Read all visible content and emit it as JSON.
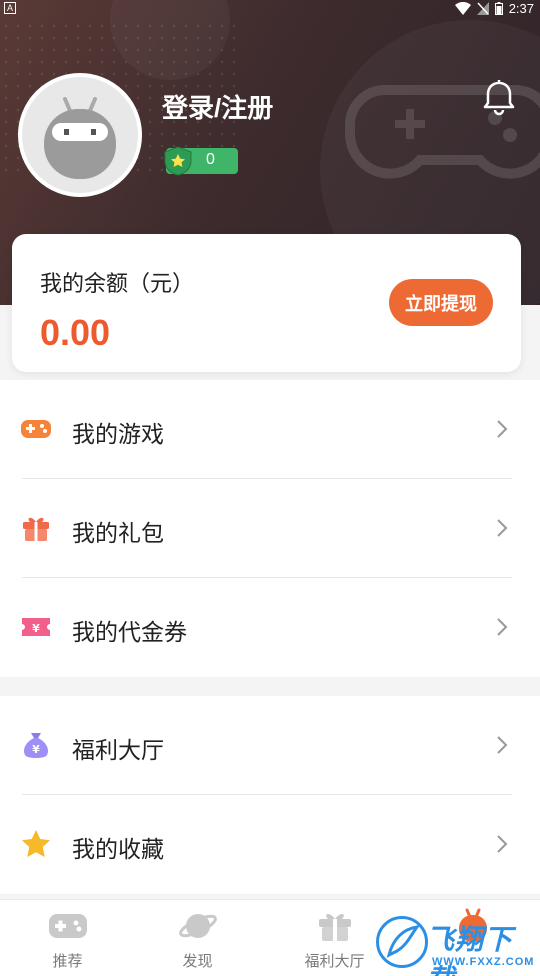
{
  "status_bar": {
    "time": "2:37",
    "left_indicator": "A"
  },
  "profile": {
    "login_label": "登录/注册",
    "level_value": "0"
  },
  "balance": {
    "title": "我的余额（元）",
    "amount": "0.00",
    "withdraw_label": "立即提现"
  },
  "menu_group_1": [
    {
      "label": "我的游戏",
      "icon": "gamepad-icon"
    },
    {
      "label": "我的礼包",
      "icon": "gift-icon"
    },
    {
      "label": "我的代金券",
      "icon": "voucher-icon"
    }
  ],
  "menu_group_2": [
    {
      "label": "福利大厅",
      "icon": "money-bag-icon"
    },
    {
      "label": "我的收藏",
      "icon": "star-icon"
    }
  ],
  "tabs": [
    {
      "label": "推荐",
      "icon": "gamepad-icon"
    },
    {
      "label": "发现",
      "icon": "planet-icon"
    },
    {
      "label": "福利大厅",
      "icon": "gift-icon"
    },
    {
      "label": "",
      "icon": "robot-icon"
    }
  ],
  "watermark": {
    "text": "飞翔下载",
    "sub": "WWW.FXXZ.COM"
  },
  "colors": {
    "accent": "#ee6a35",
    "amount": "#ee5a2e",
    "level_badge": "#3fb56a",
    "hero_bg": "#3d2b2d"
  }
}
